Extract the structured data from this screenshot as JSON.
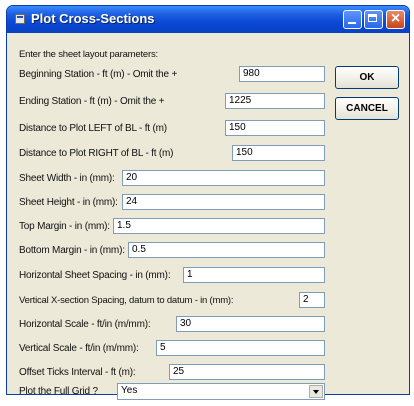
{
  "window": {
    "title": "Plot Cross-Sections"
  },
  "intro": "Enter the sheet layout parameters:",
  "fields": [
    {
      "label": "Beginning Station - ft (m) - Omit the +",
      "value": "980"
    },
    {
      "label": "Ending Station - ft (m) - Omit the +",
      "value": "1225"
    },
    {
      "label": "Distance to Plot LEFT of BL - ft (m)",
      "value": "150"
    },
    {
      "label": "Distance to Plot RIGHT of BL - ft (m)",
      "value": "150"
    },
    {
      "label": "Sheet Width - in (mm):",
      "value": "20"
    },
    {
      "label": "Sheet Height - in (mm):",
      "value": "24"
    },
    {
      "label": "Top Margin - in (mm):",
      "value": "1.5"
    },
    {
      "label": "Bottom Margin - in (mm):",
      "value": "0.5"
    },
    {
      "label": "Horizontal Sheet Spacing - in (mm):",
      "value": "1"
    },
    {
      "label": "Vertical X-section Spacing, datum to datum - in (mm):",
      "value": "2"
    },
    {
      "label": "Horizontal Scale - ft/in (m/mm):",
      "value": "30"
    },
    {
      "label": "Vertical Scale - ft/in (m/mm):",
      "value": "5"
    },
    {
      "label": "Offset Ticks Interval - ft (m):",
      "value": "25"
    }
  ],
  "grid_select": {
    "label": "Plot the Full Grid ?",
    "value": "Yes"
  },
  "buttons": {
    "ok": "OK",
    "cancel": "CANCEL"
  }
}
